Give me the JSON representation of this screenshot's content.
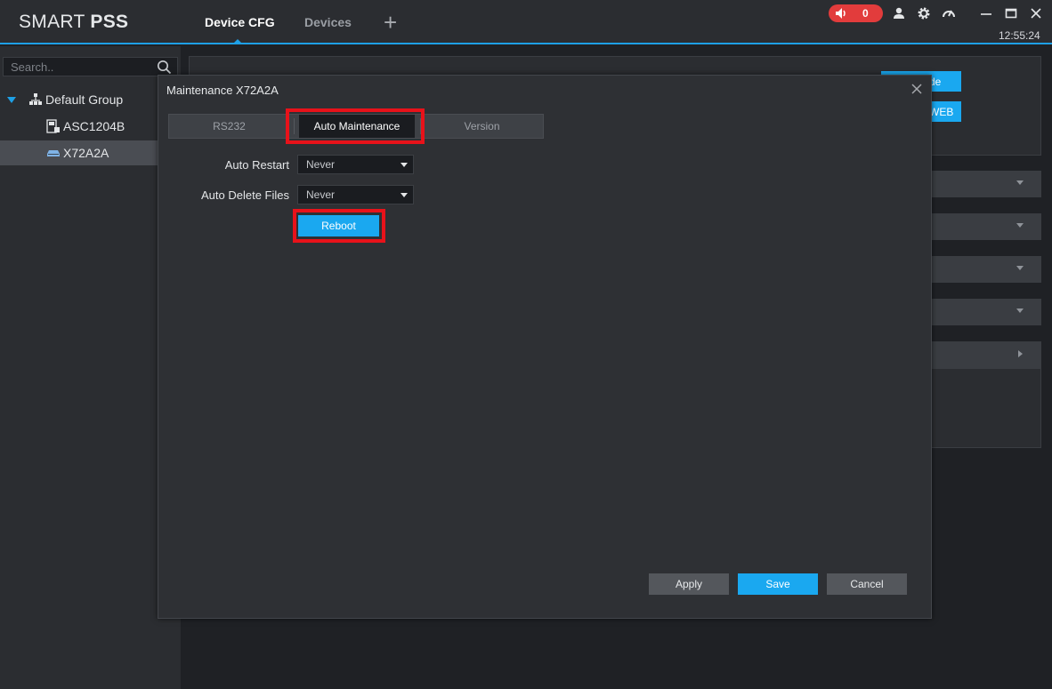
{
  "app": {
    "logo_light": "SMART ",
    "logo_bold": "PSS",
    "tabs": [
      {
        "label": "Device CFG"
      },
      {
        "label": "Devices"
      }
    ],
    "alarm_count": "0",
    "clock": "12:55:24"
  },
  "sidebar": {
    "search_placeholder": "Search..",
    "tree": [
      {
        "label": "Default Group"
      },
      {
        "label": "ASC1204B"
      },
      {
        "label": "X72A2A"
      }
    ]
  },
  "background": {
    "btn1_label": "de",
    "btn2_label": "WEB"
  },
  "dialog": {
    "title": "Maintenance X72A2A",
    "tabs": [
      {
        "label": "RS232"
      },
      {
        "label": "Auto Maintenance"
      },
      {
        "label": "Version"
      }
    ],
    "auto_restart_label": "Auto Restart",
    "auto_restart_value": "Never",
    "auto_delete_label": "Auto Delete Files",
    "auto_delete_value": "Never",
    "reboot_label": "Reboot",
    "apply_label": "Apply",
    "save_label": "Save",
    "cancel_label": "Cancel"
  },
  "colors": {
    "accent": "#1aa8f0",
    "highlight": "#e8121a",
    "alarm": "#e23c3c"
  }
}
